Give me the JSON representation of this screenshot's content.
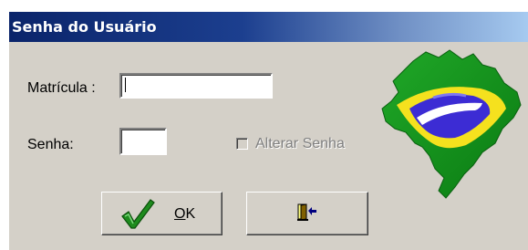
{
  "window": {
    "title": "Senha do Usuário"
  },
  "form": {
    "matricula_label": "Matrícula :",
    "matricula_value": "",
    "senha_label": "Senha:",
    "senha_value": "",
    "alterar_senha_label": "Alterar Senha",
    "alterar_senha_checked": false,
    "alterar_senha_enabled": false
  },
  "buttons": {
    "ok_label_mnemonic": "O",
    "ok_label_rest": "K",
    "ok_icon": "checkmark-icon",
    "exit_icon": "exit-door-icon"
  },
  "decor": {
    "map_icon": "brazil-map-icon"
  },
  "colors": {
    "title_bar": "#0a246a",
    "face": "#d4d0c8",
    "check_green": "#1e8b1e",
    "brazil_green": "#109618",
    "brazil_yellow": "#f5e11e",
    "brazil_blue": "#3c2cd4"
  }
}
